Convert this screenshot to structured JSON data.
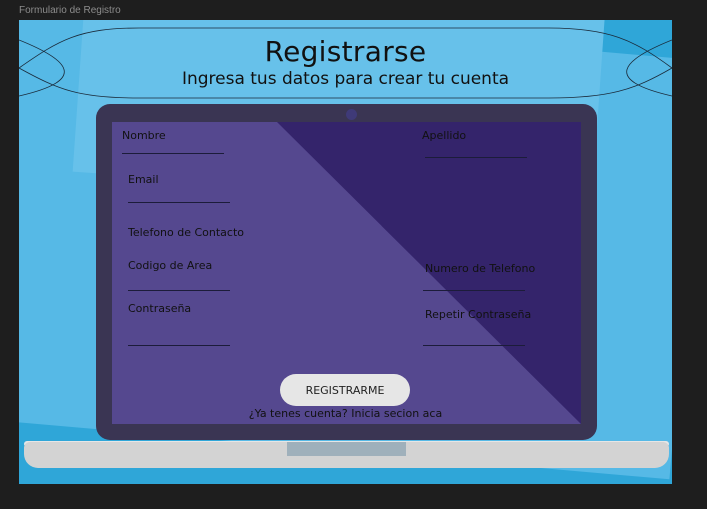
{
  "frame": {
    "label": "Formulario de Registro"
  },
  "header": {
    "title": "Registrarse",
    "subtitle": "Ingresa tus datos para crear tu cuenta"
  },
  "form": {
    "nombre": "Nombre",
    "apellido": "Apellido",
    "email": "Email",
    "telefono_contacto": "Telefono de Contacto",
    "codigo_area": "Codigo de Area",
    "numero_telefono": "Numero de Telefono",
    "contrasena": "Contraseña",
    "repetir_contrasena": "Repetir Contraseña",
    "submit_label": "REGISTRARME",
    "login_link": "¿Ya tenes cuenta? Inicia secion aca"
  },
  "colors": {
    "page_bg": "#1e1e1e",
    "canvas_bg": "#2fa6d8",
    "screen_light": "#55488f",
    "screen_dark": "#34246b",
    "button_bg": "#e6e6e6"
  }
}
